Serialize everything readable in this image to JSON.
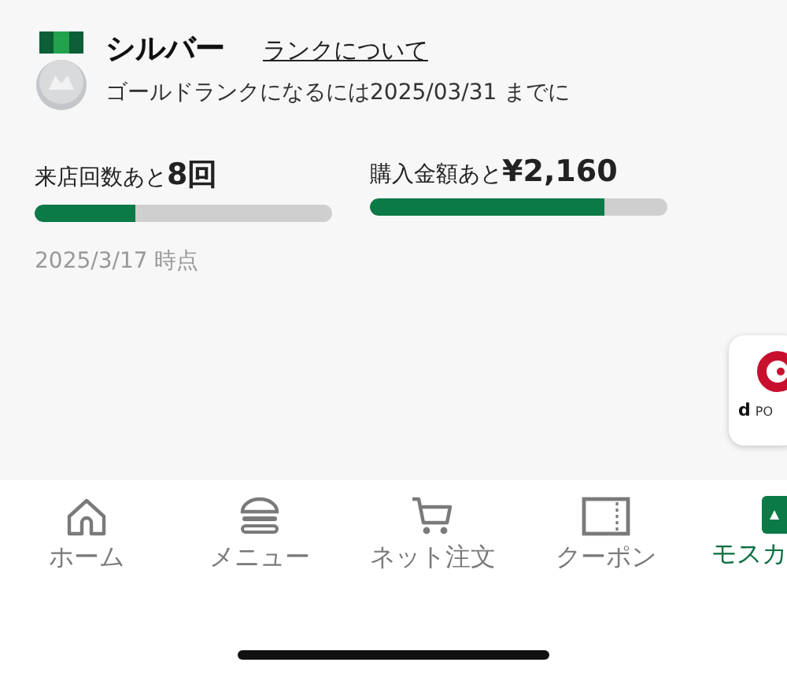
{
  "rank": {
    "name": "シルバー",
    "link": "ランクについて",
    "goal": "ゴールドランクになるには2025/03/31 までに"
  },
  "progress": [
    {
      "label": "来店回数あと",
      "value": "8回",
      "level": 0.34
    },
    {
      "label": "購入金額あと",
      "value": "¥2,160",
      "level": 0.79
    }
  ],
  "as_of": "2025/3/17 時点",
  "badge": {
    "mark": "d",
    "text": "PO"
  },
  "nav": [
    {
      "kind": "home",
      "label": "ホーム",
      "selected": false
    },
    {
      "kind": "menu",
      "label": "メニュー",
      "selected": false
    },
    {
      "kind": "cart",
      "label": "ネット注文",
      "selected": false
    },
    {
      "kind": "coupon",
      "label": "クーポン",
      "selected": false
    },
    {
      "kind": "card",
      "label": "モスカ",
      "selected": true
    }
  ]
}
